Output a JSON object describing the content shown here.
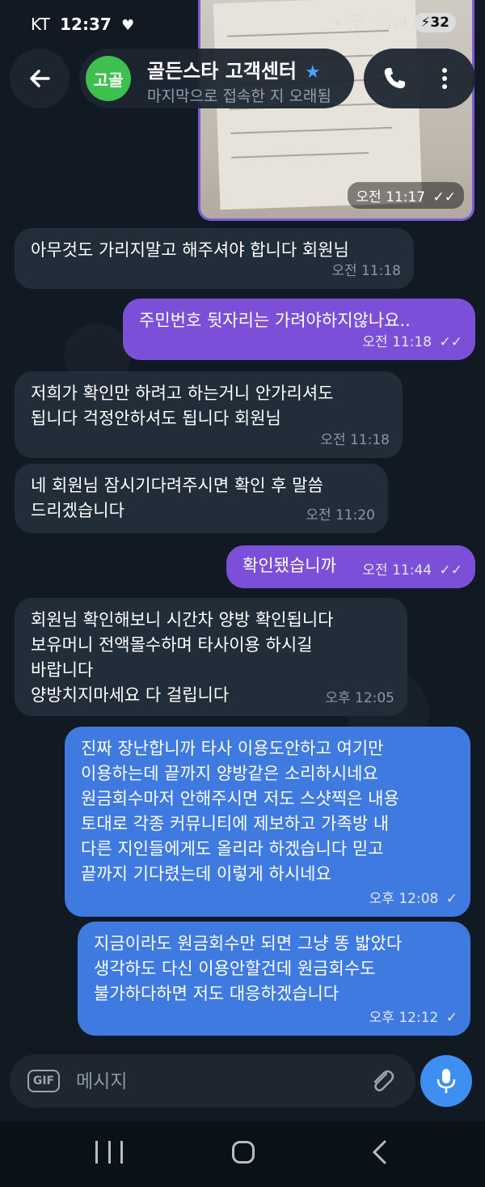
{
  "status_bar": {
    "carrier": "KT",
    "time": "12:37",
    "battery": "32"
  },
  "header": {
    "avatar_text": "고골",
    "chat_name": "골든스타 고객센터",
    "chat_status": "마지막으로 접속한 지 오래됨"
  },
  "image_message": {
    "time": "오전 11:17"
  },
  "messages": [
    {
      "text": "아무것도 가리지말고 해주셔야 합니다 회원님",
      "time": "오전 11:18"
    },
    {
      "text": "주민번호 뒷자리는 가려야하지않나요..",
      "time": "오전 11:18"
    },
    {
      "text": "저희가 확인만 하려고 하는거니 안가리셔도\n됩니다 걱정안하셔도 됩니다 회원님",
      "time": "오전 11:18"
    },
    {
      "text": "네 회원님 잠시기다려주시면 확인 후 말씀\n드리겠습니다",
      "time": "오전 11:20"
    },
    {
      "text": "확인됐습니까",
      "time": "오전 11:44"
    },
    {
      "text": "회원님 확인해보니 시간차 양방 확인됩니다\n보유머니 전액몰수하며 타사이용 하시길\n바랍니다\n양방치지마세요 다 걸립니다",
      "time": "오후 12:05"
    },
    {
      "text": "진짜 장난합니까 타사 이용도안하고 여기만\n이용하는데 끝까지 양방같은 소리하시네요\n원금회수마저 안해주시면 저도 스샷찍은 내용\n토대로 각종 커뮤니티에 제보하고 가족방 내\n다른 지인들에게도 올리라 하겠습니다 믿고\n끝까지 기다렸는데 이렇게 하시네요",
      "time": "오후 12:08"
    },
    {
      "text": "지금이라도 원금회수만 되면 그냥 똥 밟았다\n생각하도 다신 이용안할건데 원금회수도\n불가하다하면 저도 대응하겠습니다",
      "time": "오후 12:12"
    }
  ],
  "input": {
    "gif_label": "GIF",
    "placeholder": "메시지"
  }
}
